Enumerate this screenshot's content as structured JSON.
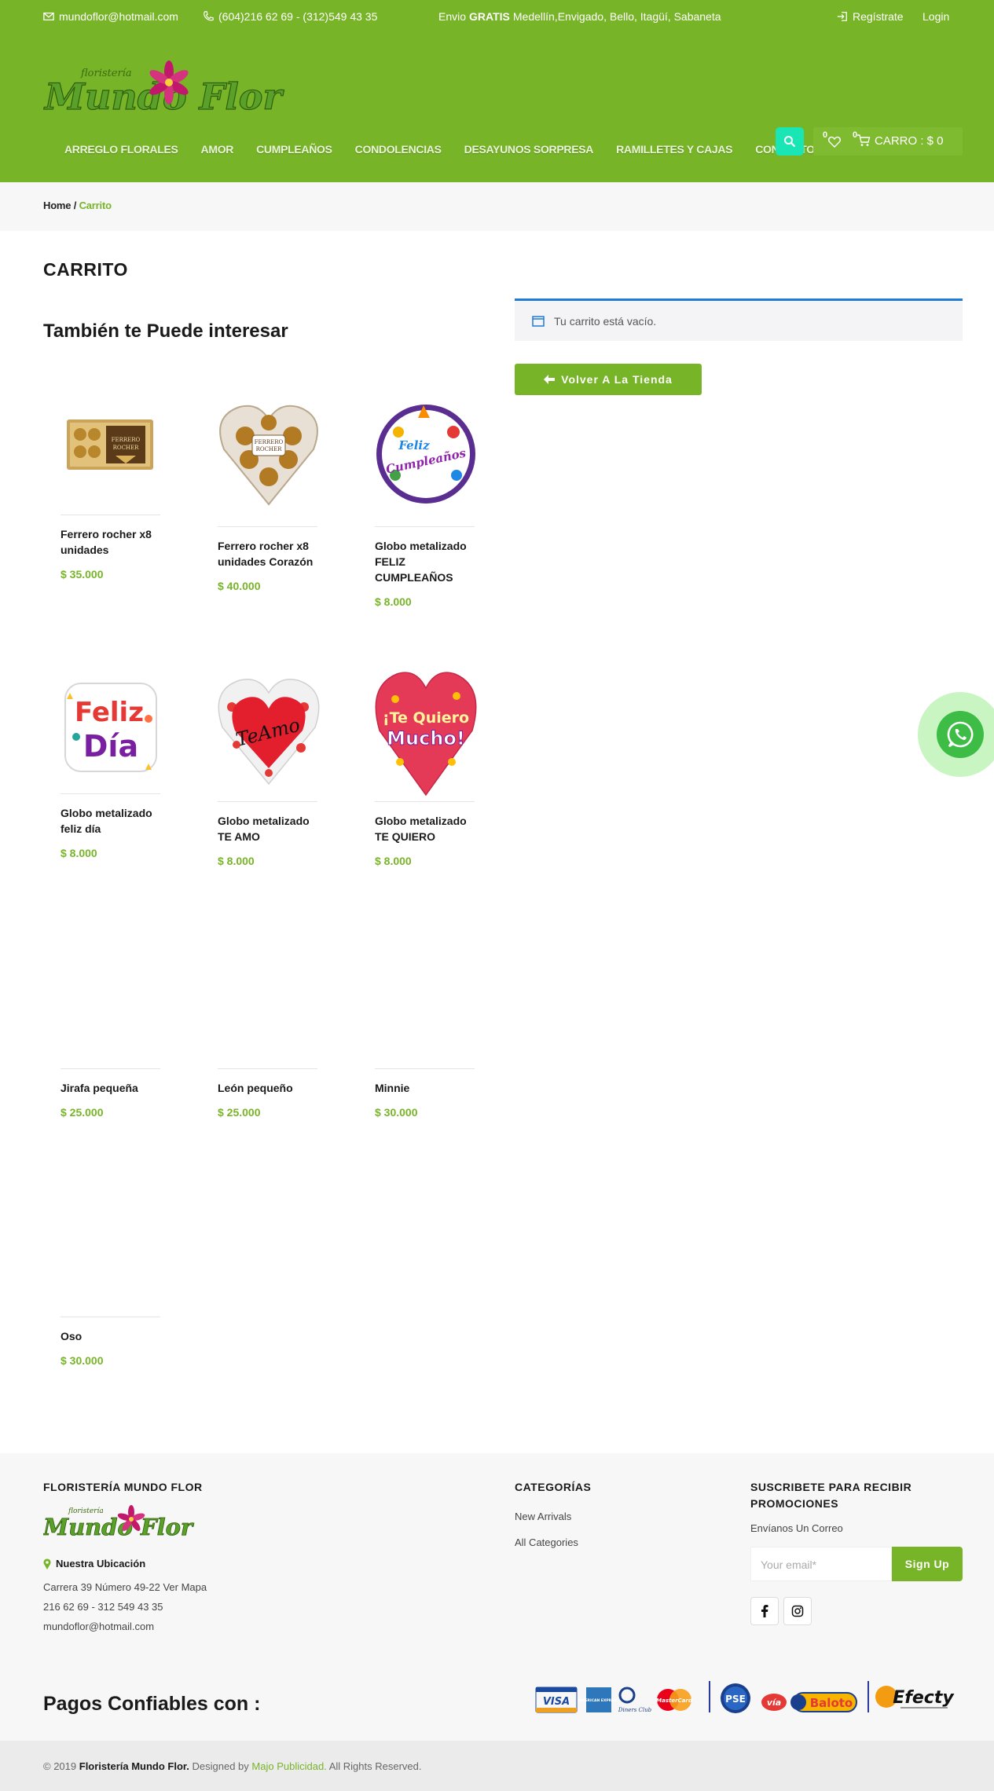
{
  "topbar": {
    "email": "mundoflor@hotmail.com",
    "phone": "(604)216 62 69 - (312)549 43 35",
    "shipping_prefix": "Envio",
    "shipping_bold": "GRATIS",
    "shipping_rest": "Medellín,Envigado, Bello, Itagüí, Sabaneta",
    "register": "Regístrate",
    "login": "Login"
  },
  "logo": {
    "small": "floristería",
    "main": "Mundo Flor"
  },
  "nav": [
    "ARREGLO FLORALES",
    "AMOR",
    "CUMPLEAÑOS",
    "CONDOLENCIAS",
    "DESAYUNOS SORPRESA",
    "RAMILLETES Y CAJAS",
    "CONTACTO"
  ],
  "header": {
    "wishlist_count": "0",
    "cart_count": "0",
    "cart_label": "CARRO : $ 0"
  },
  "breadcrumb": {
    "home": "Home",
    "sep": "/",
    "current": "Carrito"
  },
  "page_title": "CARRITO",
  "cart": {
    "empty_msg": "Tu carrito está vacío.",
    "back_button": "Volver A La Tienda"
  },
  "section_title": "También te Puede interesar",
  "products": [
    {
      "name": "Ferrero rocher x8 unidades",
      "price": "$ 35.000",
      "image": "ferrero-box"
    },
    {
      "name": "Ferrero rocher x8 unidades Corazón",
      "price": "$ 40.000",
      "image": "ferrero-heart"
    },
    {
      "name": "Globo metalizado FELIZ CUMPLEAÑOS",
      "price": "$ 8.000",
      "image": "balloon-cumpleanos"
    },
    {
      "name": "Globo metalizado feliz día",
      "price": "$ 8.000",
      "image": "balloon-feliz-dia"
    },
    {
      "name": "Globo metalizado TE AMO",
      "price": "$ 8.000",
      "image": "balloon-te-amo"
    },
    {
      "name": "Globo metalizado TE QUIERO",
      "price": "$ 8.000",
      "image": "balloon-te-quiero"
    },
    {
      "name": "Jirafa pequeña",
      "price": "$ 25.000",
      "image": "none"
    },
    {
      "name": "León pequeño",
      "price": "$ 25.000",
      "image": "none"
    },
    {
      "name": "Minnie",
      "price": "$ 30.000",
      "image": "none"
    },
    {
      "name": "Oso",
      "price": "$ 30.000",
      "image": "none"
    }
  ],
  "balloon_text": {
    "cumple_1": "Feliz",
    "cumple_2": "Cumpleaños",
    "feliz_1": "Feliz",
    "feliz_2": "Día",
    "teamo": "TeAmo",
    "tequiero_1": "¡Te Quiero",
    "tequiero_2": "Mucho!",
    "ferrero_1": "FERRERO",
    "ferrero_2": "ROCHER"
  },
  "footer": {
    "col1_title": "FLORISTERÍA MUNDO FLOR",
    "location_label": "Nuestra Ubicación",
    "address": "Carrera 39 Número 49-22 Ver Mapa",
    "phones": "216 62 69 - 312 549 43 35",
    "email": "mundoflor@hotmail.com",
    "col2_title": "CATEGORÍAS",
    "categories": [
      "New Arrivals",
      "All Categories"
    ],
    "col3_title_1": "SUSCRIBETE PARA RECIBIR",
    "col3_title_2": "PROMOCIONES",
    "subscribe_sub": "Envíanos Un Correo",
    "email_placeholder": "Your email*",
    "signup": "Sign Up",
    "payments_title": "Pagos Confiables con :",
    "payment_logos": [
      "VISA",
      "AMERICAN EXPRESS",
      "Diners Club",
      "MasterCard",
      "PSE",
      "vía",
      "Baloto",
      "Efecty"
    ]
  },
  "copyright": {
    "prefix": "© 2019",
    "brand": "Floristería Mundo Flor.",
    "mid": "Designed by",
    "designer": "Majo Publicidad.",
    "suffix": "All Rights Reserved."
  },
  "colors": {
    "brand_green": "#78b428",
    "accent_teal": "#19e6b4",
    "info_blue": "#1e7bd6",
    "whatsapp": "#3dbc46"
  }
}
